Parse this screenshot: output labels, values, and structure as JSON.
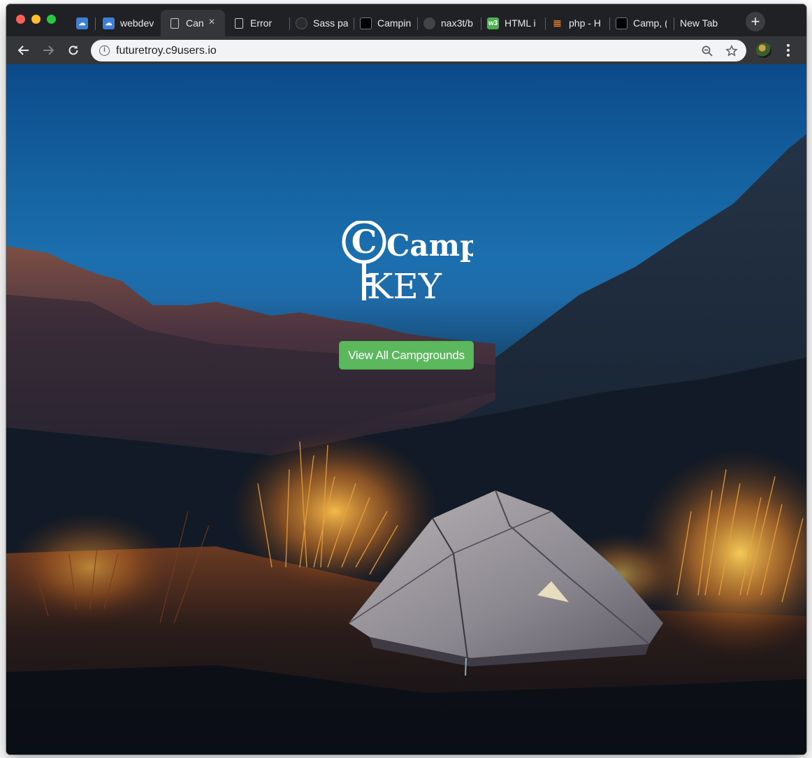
{
  "browser": {
    "tabs": [
      {
        "title": "",
        "favicon": "cloud9-icon",
        "active": false
      },
      {
        "title": "webdev",
        "favicon": "cloud9-icon",
        "active": false
      },
      {
        "title": "Can",
        "favicon": "page-icon",
        "active": true
      },
      {
        "title": "Error",
        "favicon": "page-icon",
        "active": false
      },
      {
        "title": "Sass pa",
        "favicon": "sass-icon",
        "active": false
      },
      {
        "title": "Campin",
        "favicon": "black-square-icon",
        "active": false
      },
      {
        "title": "nax3t/b",
        "favicon": "github-icon",
        "active": false
      },
      {
        "title": "HTML i",
        "favicon": "w3schools-icon",
        "active": false
      },
      {
        "title": "php - H",
        "favicon": "stackoverflow-icon",
        "active": false
      },
      {
        "title": "Camp, (",
        "favicon": "black-square-icon",
        "active": false
      },
      {
        "title": "New Tab",
        "favicon": "",
        "active": false
      }
    ],
    "new_tab_symbol": "+",
    "url": "futuretroy.c9users.io"
  },
  "page": {
    "logo_line1": "Camp",
    "logo_line2": "KEY",
    "cta_label": "View All Campgrounds",
    "colors": {
      "cta": "#5cb85c",
      "sky_top": "#0c4a8a",
      "sky_mid": "#1c6fae",
      "tent": "#8d8a90",
      "glow": "#f29a32"
    }
  }
}
